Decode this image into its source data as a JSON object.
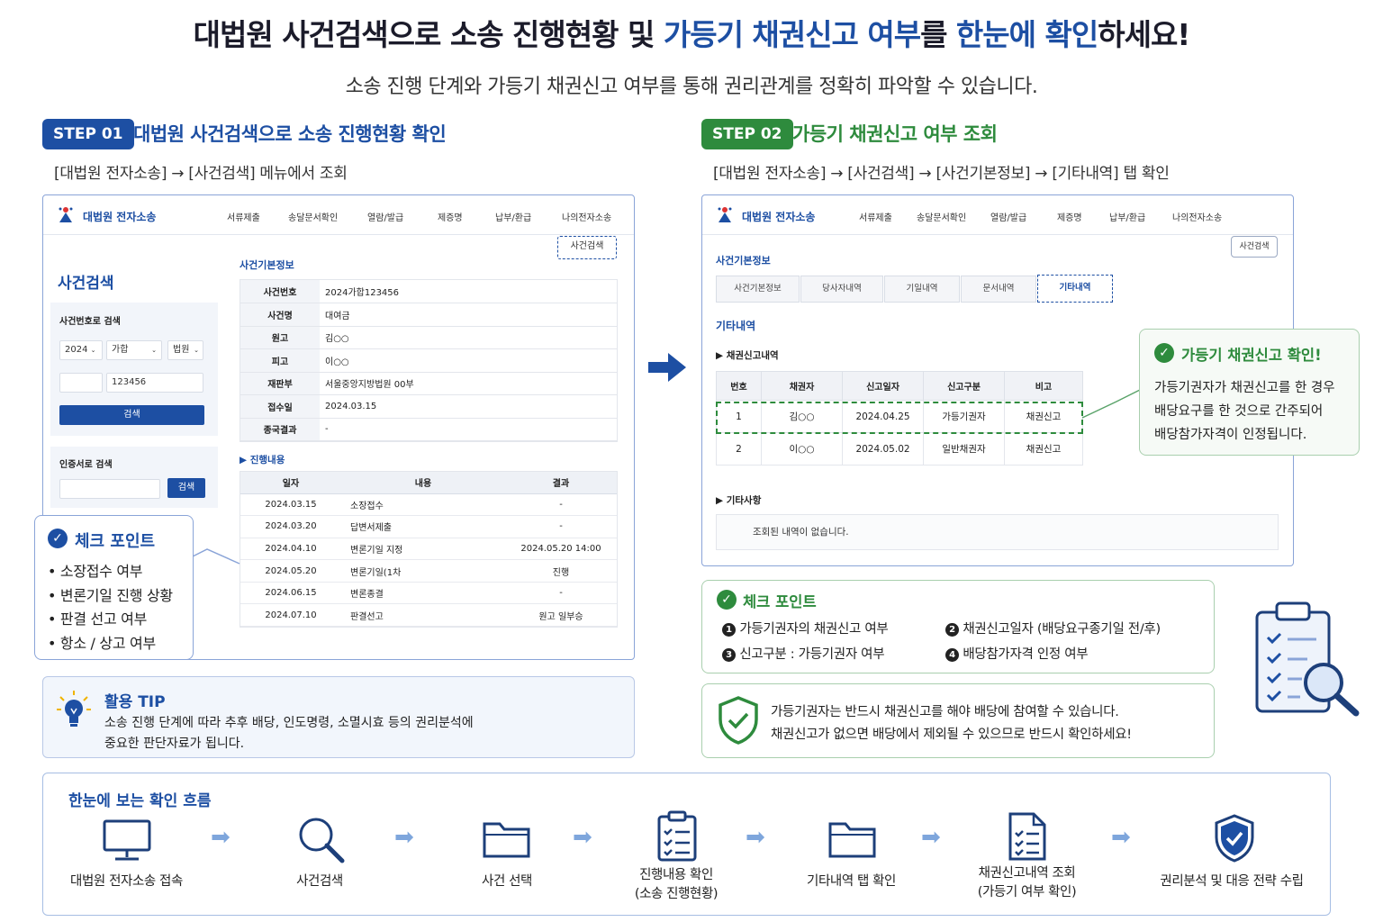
{
  "header": {
    "title_a": "대법원 사건검색으로 소송 진행현황 및 ",
    "title_b": "가등기 채권신고 여부",
    "title_c": "를 ",
    "title_d": "한눈에 확인",
    "title_e": "하세요!",
    "subtitle": "소송 진행 단계와 가등기 채권신고 여부를 통해 권리관계를 정확히 파악할 수 있습니다."
  },
  "step1": {
    "badge": "STEP 01",
    "title": "대법원 사건검색으로 소송 진행현황 확인",
    "path": "[대법원 전자소송] → [사건검색] 메뉴에서 조회",
    "logo": "대법원 전자소송",
    "nav": [
      "서류제출",
      "송달문서확인",
      "열람/발급",
      "제증명",
      "납부/환급",
      "나의전자소송"
    ],
    "search_btn": "사건검색",
    "sidebar_title": "사건검색",
    "case_search_label": "사건번호로 검색",
    "year": "2024",
    "case_type": "가합",
    "court_sel": "법원",
    "case_number": "123456",
    "search_label": "검색",
    "cert_search_label": "인증서로 검색",
    "cert_btn": "검색",
    "basic_info_title": "사건기본정보",
    "info": [
      {
        "k": "사건번호",
        "v": "2024가합123456"
      },
      {
        "k": "사건명",
        "v": "대여금"
      },
      {
        "k": "원고",
        "v": "김○○"
      },
      {
        "k": "피고",
        "v": "이○○"
      },
      {
        "k": "재판부",
        "v": "서울중앙지방법원 00부"
      },
      {
        "k": "접수일",
        "v": "2024.03.15"
      },
      {
        "k": "종국결과",
        "v": "-"
      }
    ],
    "progress_title": "▶ 진행내용",
    "progress_headers": [
      "일자",
      "내용",
      "결과"
    ],
    "progress_rows": [
      [
        "2024.03.15",
        "소장접수",
        "-"
      ],
      [
        "2024.03.20",
        "답변서제출",
        "-"
      ],
      [
        "2024.04.10",
        "변론기일 지정",
        "2024.05.20 14:00"
      ],
      [
        "2024.05.20",
        "변론기일(1차",
        "진행"
      ],
      [
        "2024.06.15",
        "변론종결",
        "-"
      ],
      [
        "2024.07.10",
        "판결선고",
        "원고 일부승"
      ]
    ],
    "checkpoint_title": "체크 포인트",
    "checkpoints": [
      "• 소장접수 여부",
      "• 변론기일 진행 상황",
      "• 판결 선고 여부",
      "• 항소 / 상고 여부"
    ],
    "tip_title": "활용 TIP",
    "tip_line1": "소송 진행 단계에 따라 추후 배당, 인도명령, 소멸시효 등의 권리분석에",
    "tip_line2": "중요한 판단자료가 됩니다."
  },
  "step2": {
    "badge": "STEP 02",
    "title": "가등기 채권신고 여부 조회",
    "path": "[대법원 전자소송] → [사건검색] → [사건기본정보] → [기타내역] 탭 확인",
    "logo": "대법원 전자소송",
    "nav": [
      "서류제출",
      "송달문서확인",
      "열람/발급",
      "제증명",
      "납부/환급",
      "나의전자소송"
    ],
    "search_btn": "사건검색",
    "basic_info_title": "사건기본정보",
    "tabs": [
      "사건기본정보",
      "당사자내역",
      "기일내역",
      "문서내역",
      "기타내역"
    ],
    "etc_title": "기타내역",
    "claim_title": "▶ 채권신고내역",
    "claim_headers": [
      "번호",
      "채권자",
      "신고일자",
      "신고구분",
      "비고"
    ],
    "claim_rows": [
      [
        "1",
        "김○○",
        "2024.04.25",
        "가등기권자",
        "채권신고"
      ],
      [
        "2",
        "이○○",
        "2024.05.02",
        "일반채권자",
        "채권신고"
      ]
    ],
    "other_title": "▶ 기타사항",
    "no_result": "조회된 내역이 없습니다.",
    "callout_title": "가등기 채권신고 확인!",
    "callout_line1": "가등기권자가 채권신고를 한 경우",
    "callout_line2": "배당요구를 한 것으로 간주되어",
    "callout_line3": "배당참가자격이 인정됩니다.",
    "checkpoint_title": "체크 포인트",
    "cp1": "가등기권자의 채권신고 여부",
    "cp2": "채권신고일자 (배당요구종기일 전/후)",
    "cp3": "신고구분 : 가등기권자 여부",
    "cp4": "배당참가자격 인정 여부",
    "warn_line1": "가등기권자는 반드시 채권신고를 해야 배당에 참여할 수 있습니다.",
    "warn_line2": "채권신고가 없으면 배당에서 제외될 수 있으므로 반드시 확인하세요!"
  },
  "flow": {
    "title": "한눈에 보는 확인 흐름",
    "steps": [
      {
        "icon": "monitor-icon",
        "line1": "대법원 전자소송 접속",
        "line2": ""
      },
      {
        "icon": "magnifier-icon",
        "line1": "사건검색",
        "line2": ""
      },
      {
        "icon": "folder-icon",
        "line1": "사건 선택",
        "line2": ""
      },
      {
        "icon": "clipboard-icon",
        "line1": "진행내용 확인",
        "line2": "(소송 진행현황)"
      },
      {
        "icon": "folder-icon",
        "line1": "기타내역 탭 확인",
        "line2": ""
      },
      {
        "icon": "checklist-doc-icon",
        "line1": "채권신고내역 조회",
        "line2": "(가등기 여부 확인)"
      },
      {
        "icon": "shield-check-icon",
        "line1": "권리분석 및 대응 전략 수립",
        "line2": ""
      }
    ]
  },
  "colors": {
    "blue": "#1d4fa3",
    "green": "#2e8b3d",
    "navy": "#1b1b2a"
  }
}
